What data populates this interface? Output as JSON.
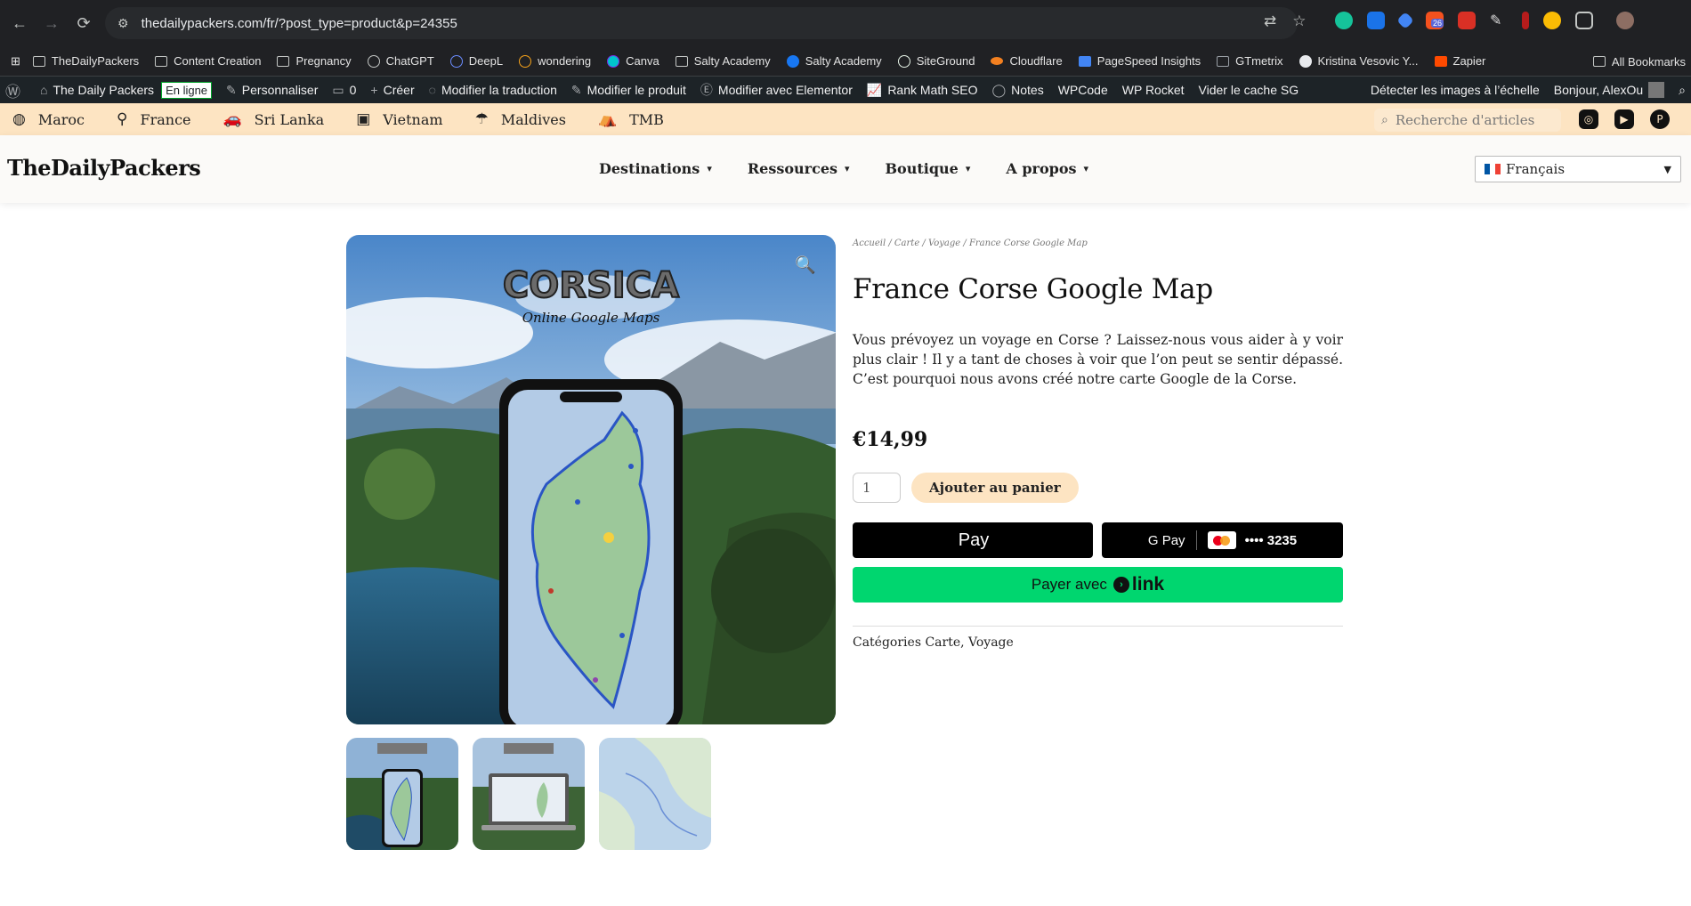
{
  "browser": {
    "url": "thedailypackers.com/fr/?post_type=product&p=24355",
    "ext_badge": "26"
  },
  "bookmarks": {
    "items": [
      "TheDailyPackers",
      "Content Creation",
      "Pregnancy",
      "ChatGPT",
      "DeepL",
      "wondering",
      "Canva",
      "Salty Academy",
      "Salty Academy",
      "SiteGround",
      "Cloudflare",
      "PageSpeed Insights",
      "GTmetrix",
      "Kristina Vesovic Y...",
      "Zapier"
    ],
    "all": "All Bookmarks"
  },
  "wpbar": {
    "site": "The Daily Packers",
    "status": "En ligne",
    "customize": "Personnaliser",
    "comments": "0",
    "create": "Créer",
    "translate": "Modifier la traduction",
    "edit_product": "Modifier le produit",
    "elementor": "Modifier avec Elementor",
    "rankmath": "Rank Math SEO",
    "notes": "Notes",
    "wpcode": "WPCode",
    "wprocket": "WP Rocket",
    "cache": "Vider le cache SG",
    "detect": "Détecter les images à l’échelle",
    "hello": "Bonjour, AlexOu"
  },
  "topnav": {
    "items": [
      "Maroc",
      "France",
      "Sri Lanka",
      "Vietnam",
      "Maldives",
      "TMB"
    ],
    "search_placeholder": "Recherche d'articles"
  },
  "header": {
    "logo": "TheDailyPackers",
    "menu": [
      "Destinations",
      "Ressources",
      "Boutique",
      "A propos"
    ],
    "language": "Français"
  },
  "product": {
    "image_title": "CORSICA",
    "image_subtitle": "Online Google Maps",
    "breadcrumb": "Accueil / Carte / Voyage / France Corse Google Map",
    "title": "France Corse Google Map",
    "description": "Vous prévoyez un voyage en Corse ? Laissez-nous vous aider à y voir plus clair ! Il y a tant de choses à voir que l’on peut se sentir dépassé. C’est pourquoi nous avons créé notre carte Google de la Corse.",
    "price": "€14,99",
    "quantity": "1",
    "add_to_cart": "Ajouter au panier",
    "apple_pay": "Pay",
    "google_pay": "G Pay",
    "card_last4": "•••• 3235",
    "link_pay_prefix": "Payer avec",
    "link_word": "link",
    "categories_label": "Catégories",
    "category_1": "Carte",
    "category_2": "Voyage"
  },
  "colors": {
    "topnav_bg": "#fde4c2",
    "link_green": "#00d66f",
    "wp_bar": "#1d2327"
  }
}
